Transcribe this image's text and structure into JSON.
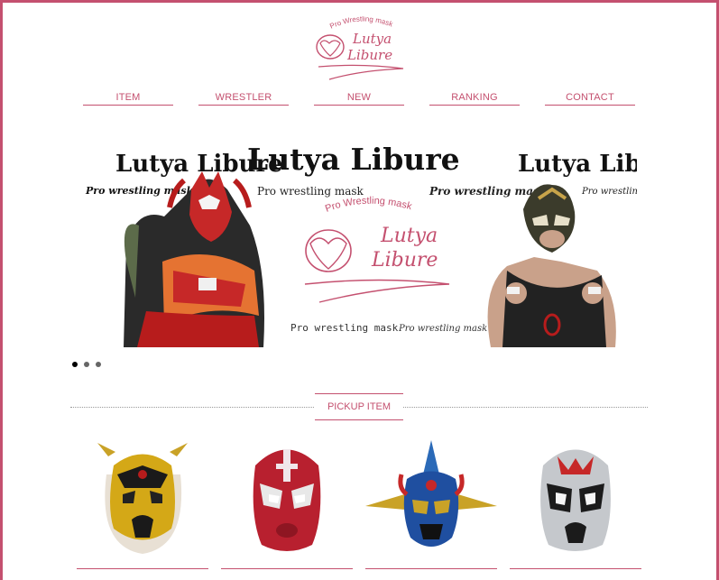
{
  "site": {
    "logo_top": "Pro Wrestling mask",
    "logo_name_1": "Lutya",
    "logo_name_2": "Libure",
    "accent_color": "#c4506f"
  },
  "nav": {
    "items": [
      {
        "label": "ITEM"
      },
      {
        "label": "WRESTLER"
      },
      {
        "label": "NEW"
      },
      {
        "label": "RANKING"
      },
      {
        "label": "CONTACT"
      }
    ]
  },
  "hero": {
    "left_title": "Lutya Libure",
    "left_sub": "Pro wrestling mask",
    "center_title": "Lutya Libure",
    "center_sub_left": "Pro wrestling mask",
    "center_sub_right": "Pro wrestling mask",
    "center_logo_top": "Pro Wrestling mask",
    "center_logo_name_1": "Lutya",
    "center_logo_name_2": "Libure",
    "bottom_left": "Pro wrestling mask",
    "bottom_right": "Pro wrestling mask",
    "right_title": "Lutya Libure",
    "right_sub": "Pro wrestling mask",
    "slides_count": 3,
    "active_slide": 1
  },
  "pickup": {
    "title": "PICKUP ITEM",
    "items": [
      {
        "icon": "tiger-mask-icon"
      },
      {
        "icon": "red-mask-icon"
      },
      {
        "icon": "liger-mask-icon"
      },
      {
        "icon": "silver-mask-icon"
      }
    ]
  }
}
